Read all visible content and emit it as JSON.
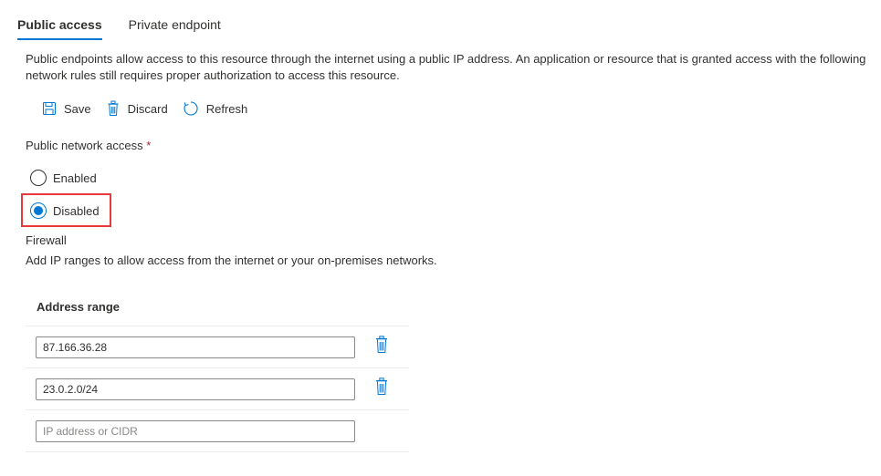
{
  "tabs": [
    {
      "label": "Public access",
      "active": true
    },
    {
      "label": "Private endpoint",
      "active": false
    }
  ],
  "description": "Public endpoints allow access to this resource through the internet using a public IP address. An application or resource that is granted access with the following network rules still requires proper authorization to access this resource.",
  "toolbar": {
    "save_label": "Save",
    "discard_label": "Discard",
    "refresh_label": "Refresh"
  },
  "public_network_access": {
    "label": "Public network access",
    "required_mark": "*",
    "options": [
      {
        "label": "Enabled",
        "checked": false
      },
      {
        "label": "Disabled",
        "checked": true
      }
    ]
  },
  "firewall": {
    "title": "Firewall",
    "description": "Add IP ranges to allow access from the internet or your on-premises networks.",
    "column_header": "Address range",
    "rows": [
      {
        "value": "87.166.36.28"
      },
      {
        "value": "23.0.2.0/24"
      }
    ],
    "new_row_placeholder": "IP address or CIDR"
  },
  "colors": {
    "accent": "#0078d4",
    "highlight": "#e8393c",
    "icon": "#0078d4"
  }
}
